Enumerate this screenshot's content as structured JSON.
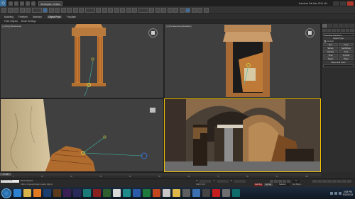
{
  "titlebar": {
    "workspace": "Workspace: Default",
    "title": "Autodesk 3ds Max 2014 x64"
  },
  "ribbon": {
    "tabs": [
      "Modeling",
      "Freeform",
      "Selection",
      "Object Paint",
      "Populate"
    ],
    "active_tab": "Object Paint",
    "subtabs": [
      "Paint Objects",
      "Brush Settings"
    ]
  },
  "viewports": {
    "top_left": "[+] [Top] [Wireframe]",
    "top_right": "[+] [Perspective] [Realistic]",
    "bottom_left": "[+] [Front] [Realistic]",
    "bottom_right": "[+] [Camera001] [Realistic]"
  },
  "command_panel": {
    "category": "Standard Primitives",
    "object_type_header": "Object Type",
    "autogrid": "AutoGrid",
    "objects": [
      "Box",
      "Cone",
      "Sphere",
      "GeoSphere",
      "Cylinder",
      "Tube",
      "Torus",
      "Pyramid",
      "Teapot",
      "Plane"
    ],
    "name_color_header": "Name and Color"
  },
  "timeline": {
    "slider": "0 / 100",
    "ticks": [
      "0",
      "10",
      "20",
      "30",
      "40",
      "50",
      "60",
      "70",
      "80",
      "90",
      "100"
    ]
  },
  "status": {
    "script_box": "Welcome to M",
    "msg1": "None Selected",
    "msg2": "Click or click-and-drag to select objects",
    "x_label": "X:",
    "y_label": "Y:",
    "z_label": "Z:",
    "grid": "Grid = 10.0",
    "autokey": "Auto Key",
    "setkey": "Set Key",
    "selected": "Selected",
    "frame": "0",
    "keyfilters": "Key Filters..."
  },
  "taskbar": {
    "apps": [
      {
        "name": "ie",
        "color": "#2d7fd0"
      },
      {
        "name": "explorer",
        "color": "#d9b24a"
      },
      {
        "name": "media",
        "color": "#e07b24"
      },
      {
        "name": "photoshop",
        "color": "#1c3e6e"
      },
      {
        "name": "illustrator",
        "color": "#5a3a1a"
      },
      {
        "name": "premiere",
        "color": "#3a1f55"
      },
      {
        "name": "aftereffects",
        "color": "#2a2a5a"
      },
      {
        "name": "3dsmax",
        "color": "#1a7a78"
      },
      {
        "name": "flash",
        "color": "#8a1f1f"
      },
      {
        "name": "dreamweaver",
        "color": "#2e5e2e"
      },
      {
        "name": "chrome",
        "color": "#d9d9d9"
      },
      {
        "name": "maya",
        "color": "#1e8a8a"
      },
      {
        "name": "word",
        "color": "#2a5aa8"
      },
      {
        "name": "excel",
        "color": "#1e7a3a"
      },
      {
        "name": "powerpoint",
        "color": "#c2471f"
      },
      {
        "name": "player",
        "color": "#c7c7c7"
      },
      {
        "name": "folder",
        "color": "#e0b84a"
      },
      {
        "name": "camera",
        "color": "#5e5e5e"
      },
      {
        "name": "mail",
        "color": "#3a6fb0"
      },
      {
        "name": "calc",
        "color": "#444444"
      },
      {
        "name": "acrobat",
        "color": "#c41e1e"
      },
      {
        "name": "settings",
        "color": "#6e6e6e"
      },
      {
        "name": "max-active",
        "color": "#0f6a6a"
      }
    ],
    "time": "4:08 PM",
    "date": "9/13/2013"
  }
}
